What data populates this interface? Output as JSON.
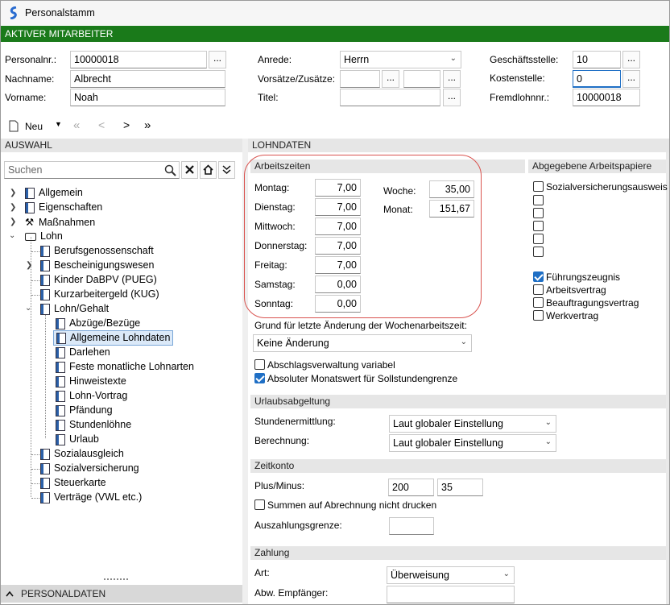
{
  "window": {
    "title": "Personalstamm"
  },
  "banner": {
    "title": "AKTIVER MITARBEITER"
  },
  "employee": {
    "personalnr_label": "Personalnr.:",
    "personalnr_value": "10000018",
    "nachname_label": "Nachname:",
    "nachname_value": "Albrecht",
    "vorname_label": "Vorname:",
    "vorname_value": "Noah",
    "anrede_label": "Anrede:",
    "anrede_value": "Herrn",
    "vorsaetze_label": "Vorsätze/Zusätze:",
    "titel_label": "Titel:",
    "geschaeftsstelle_label": "Geschäftsstelle:",
    "geschaeftsstelle_value": "10",
    "kostenstelle_label": "Kostenstelle:",
    "kostenstelle_value": "0",
    "fremdlohnnr_label": "Fremdlohnnr.:",
    "fremdlohnnr_value": "10000018",
    "ellipsis": "..."
  },
  "toolbar": {
    "new_label": "Neu",
    "first": "«",
    "prev": "<",
    "next": ">",
    "last": "»"
  },
  "left": {
    "header": "AUSWAHL",
    "search_placeholder": "Suchen",
    "footer": "PERSONALDATEN",
    "tree": [
      {
        "label": "Allgemein"
      },
      {
        "label": "Eigenschaften"
      },
      {
        "label": "Maßnahmen"
      },
      {
        "label": "Lohn"
      },
      {
        "label": "Berufsgenossenschaft"
      },
      {
        "label": "Bescheinigungswesen"
      },
      {
        "label": "Kinder DaBPV (PUEG)"
      },
      {
        "label": "Kurzarbeitergeld (KUG)"
      },
      {
        "label": "Lohn/Gehalt"
      },
      {
        "label": "Abzüge/Bezüge"
      },
      {
        "label": "Allgemeine Lohndaten"
      },
      {
        "label": "Darlehen"
      },
      {
        "label": "Feste monatliche Lohnarten"
      },
      {
        "label": "Hinweistexte"
      },
      {
        "label": "Lohn-Vortrag"
      },
      {
        "label": "Pfändung"
      },
      {
        "label": "Stundenlöhne"
      },
      {
        "label": "Urlaub"
      },
      {
        "label": "Sozialausgleich"
      },
      {
        "label": "Sozialversicherung"
      },
      {
        "label": "Steuerkarte"
      },
      {
        "label": "Verträge (VWL etc.)"
      }
    ]
  },
  "main": {
    "header": "LOHNDATEN",
    "arbeitszeiten": {
      "title": "Arbeitszeiten",
      "days": [
        {
          "label": "Montag:",
          "value": "7,00"
        },
        {
          "label": "Dienstag:",
          "value": "7,00"
        },
        {
          "label": "Mittwoch:",
          "value": "7,00"
        },
        {
          "label": "Donnerstag:",
          "value": "7,00"
        },
        {
          "label": "Freitag:",
          "value": "7,00"
        },
        {
          "label": "Samstag:",
          "value": "0,00"
        },
        {
          "label": "Sonntag:",
          "value": "0,00"
        }
      ],
      "woche_label": "Woche:",
      "woche_value": "35,00",
      "monat_label": "Monat:",
      "monat_value": "151,67"
    },
    "grund_label": "Grund für letzte Änderung der Wochenarbeitszeit:",
    "grund_value": "Keine Änderung",
    "abschlag_label": "Abschlagsverwaltung variabel",
    "absolut_label": "Absoluter Monatswert für Sollstundengrenze",
    "urlaub": {
      "title": "Urlaubsabgeltung",
      "stunden_label": "Stundenermittlung:",
      "stunden_value": "Laut globaler Einstellung",
      "berechnung_label": "Berechnung:",
      "berechnung_value": "Laut globaler Einstellung"
    },
    "zeitkonto": {
      "title": "Zeitkonto",
      "plusminus_label": "Plus/Minus:",
      "plus_value": "200",
      "minus_value": "35",
      "summen_label": "Summen auf Abrechnung nicht drucken",
      "auszahlung_label": "Auszahlungsgrenze:"
    },
    "zahlung": {
      "title": "Zahlung",
      "art_label": "Art:",
      "art_value": "Überweisung",
      "empf_label": "Abw. Empfänger:"
    }
  },
  "papiere": {
    "title": "Abgegebene Arbeitspapiere",
    "items": [
      {
        "label": "Sozialversicherungsausweis",
        "checked": false
      },
      {
        "label": "",
        "checked": false
      },
      {
        "label": "",
        "checked": false
      },
      {
        "label": "",
        "checked": false
      },
      {
        "label": "",
        "checked": false
      },
      {
        "label": "",
        "checked": false
      },
      {
        "label": "Führungszeugnis",
        "checked": true
      },
      {
        "label": "Arbeitsvertrag",
        "checked": false
      },
      {
        "label": "Beauftragungsvertrag",
        "checked": false
      },
      {
        "label": "Werkvertrag",
        "checked": false
      }
    ]
  },
  "colors": {
    "banner": "#1a7a1a",
    "highlight": "#d9534f",
    "accent": "#1f6fc5"
  }
}
